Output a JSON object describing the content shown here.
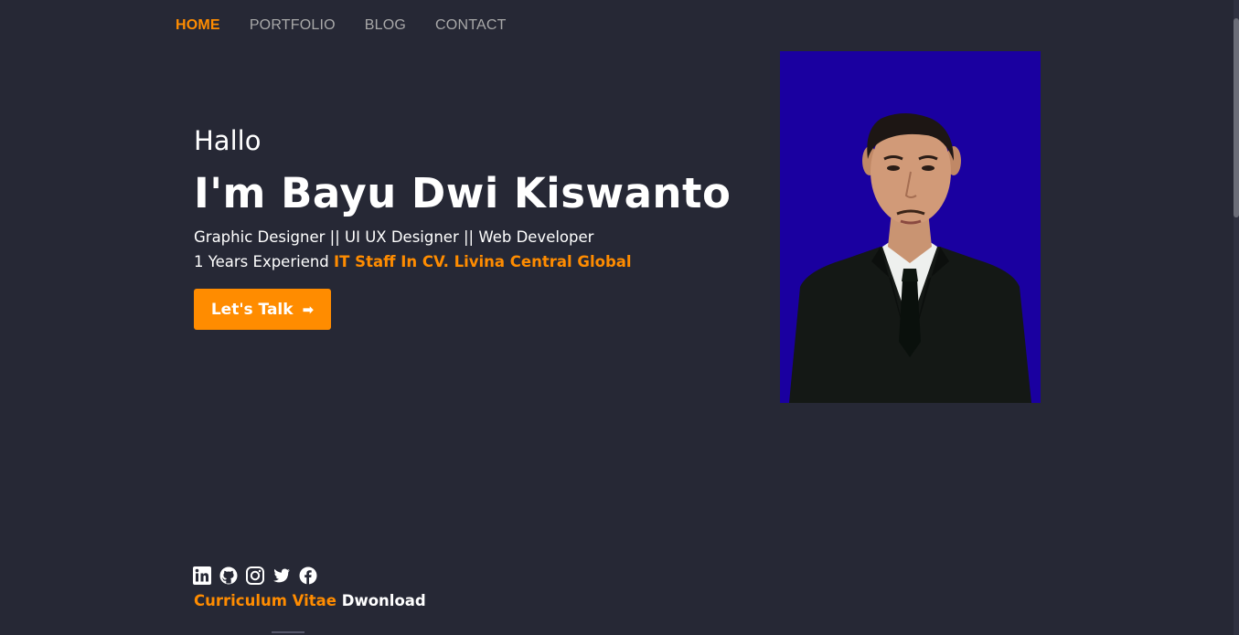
{
  "nav": {
    "items": [
      {
        "label": "HOME",
        "active": true
      },
      {
        "label": "PORTFOLIO",
        "active": false
      },
      {
        "label": "BLOG",
        "active": false
      },
      {
        "label": "CONTACT",
        "active": false
      }
    ]
  },
  "hero": {
    "greeting": "Hallo",
    "name": "I'm Bayu Dwi Kiswanto",
    "roles": "Graphic Designer || UI UX Designer || Web Developer",
    "experience_prefix": "1 Years Experiend",
    "experience_highlight": "IT Staff In CV. Livina Central Global",
    "cta_label": "Let's Talk",
    "cta_icon": "arrow-right-icon"
  },
  "photo": {
    "alt": "Profile photo",
    "background": "#1a00a0"
  },
  "socials": [
    "linkedin-icon",
    "github-icon",
    "instagram-icon",
    "twitter-icon",
    "facebook-icon"
  ],
  "cv": {
    "highlight": "Curriculum Vitae",
    "rest": "Dwonload"
  },
  "colors": {
    "accent": "#ff8c00",
    "background": "#262835",
    "text": "#ffffff",
    "nav_inactive": "#a9a9a9"
  }
}
